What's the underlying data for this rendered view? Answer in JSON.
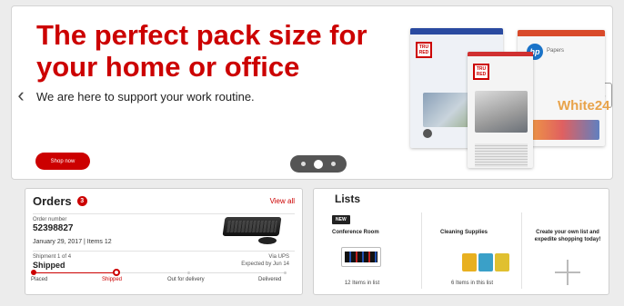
{
  "hero": {
    "title": "The perfect pack size for your home or office",
    "subtitle": "We are here to support your work routine.",
    "cta_label": "Shop now",
    "prev_icon": "chevron-left-icon",
    "next_icon": "chevron-right-icon",
    "slide_count": 3,
    "active_slide": 2,
    "products": [
      "TRU RED Color Photo Paper",
      "TRU RED Photo Paper",
      "HP Papers White 24"
    ],
    "accent_color": "#cc0000"
  },
  "orders": {
    "title": "Orders",
    "count": "3",
    "view_all": "View all",
    "order_number_label": "Order number",
    "order_number": "52398827",
    "date_items": "January 29, 2017  |  Items 12",
    "shipment_label": "Shipment 1 of 4",
    "status": "Shipped",
    "carrier": "Via UPS",
    "expected": "Expected by Jun 14",
    "steps": [
      "Placed",
      "Shipped",
      "Out for delivery",
      "Delivered"
    ],
    "current_step": 1
  },
  "lists": {
    "title": "Lists",
    "items": [
      {
        "tag": "NEW",
        "name": "Conference Room",
        "count": "12 Items in list"
      },
      {
        "name": "Cleaning Supplies",
        "count": "6 Items in this list"
      }
    ],
    "create_text": "Create your own list and expedite shopping today!"
  }
}
